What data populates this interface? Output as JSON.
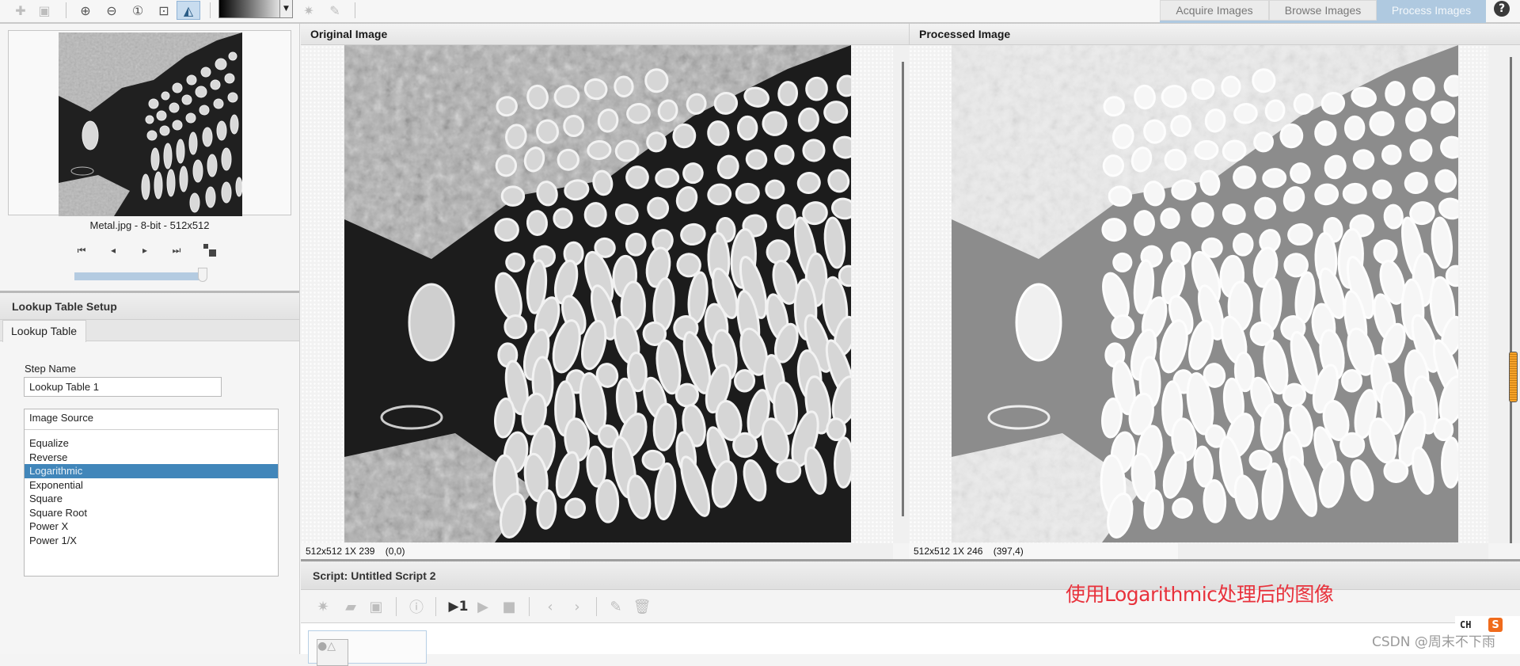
{
  "toolbar": {
    "icons": [
      "add-image-icon",
      "save-image-icon",
      "zoom-in-icon",
      "zoom-out-icon",
      "zoom-1to1-icon",
      "zoom-fit-icon",
      "palette-view-icon",
      "lut-gradient-dropdown",
      "threshold-icon",
      "pencil-icon"
    ],
    "lut_dropdown_value": "Grayscale"
  },
  "mode_tabs": [
    {
      "label": "Acquire Images",
      "active": false
    },
    {
      "label": "Browse Images",
      "active": false
    },
    {
      "label": "Process Images",
      "active": true
    }
  ],
  "help_label": "?",
  "left_panel": {
    "preview_caption": "Metal.jpg - 8-bit - 512x512",
    "nav": [
      "first-icon",
      "prev-icon",
      "next-icon",
      "last-icon",
      "toggle-view-icon"
    ],
    "slider_position_fraction": 0.95,
    "setup_title": "Lookup Table Setup",
    "tab_label": "Lookup Table",
    "step_name_label": "Step Name",
    "step_name_value": "Lookup Table 1",
    "image_source_label": "Image Source",
    "lut_options": [
      "Equalize",
      "Reverse",
      "Logarithmic",
      "Exponential",
      "Square",
      "Square Root",
      "Power X",
      "Power 1/X"
    ],
    "selected_option": "Logarithmic"
  },
  "panes": {
    "original": {
      "title": "Original Image",
      "status_size": "512x512 1X 239",
      "status_coord": "(0,0)"
    },
    "processed": {
      "title": "Processed Image",
      "status_size": "512x512 1X 246",
      "status_coord": "(397,4)"
    }
  },
  "script": {
    "title": "Script: Untitled Script 2",
    "run_once_label": "▶1"
  },
  "annotation": "使用Logarithmic处理后的图像",
  "ime_label": "CH",
  "watermark": "CSDN @周末不下雨",
  "colors": {
    "accent_tab": "#afc9e0",
    "selection": "#4186ba",
    "annotation": "#e8323c"
  }
}
